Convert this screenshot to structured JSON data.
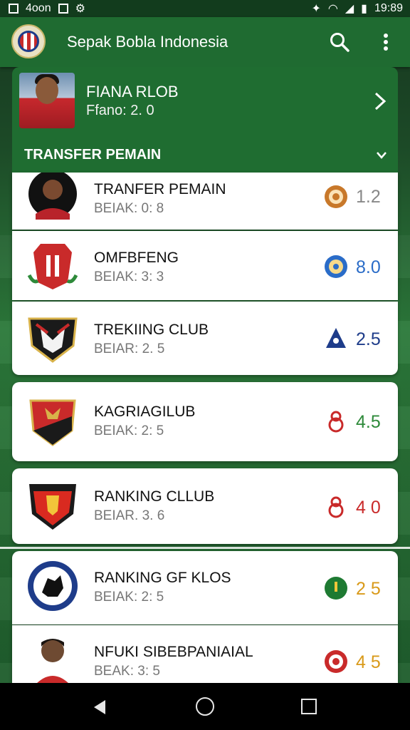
{
  "status_bar": {
    "left_text": "4oon",
    "time": "19:89"
  },
  "app_bar": {
    "title": "Sepak Bobla Indonesia",
    "icons": [
      "club-logo-icon",
      "search-icon",
      "more-vert-icon"
    ]
  },
  "featured": {
    "title": "FIANA RLOB",
    "subtitle": "Ffano: 2. 0"
  },
  "section": {
    "title": "TRANSFER PEMAIN"
  },
  "items": [
    {
      "name": "TRANFER PEMAIN",
      "sub": "BEIAK: 0: 8",
      "rank": "1.2",
      "badge_color": "#c8782a",
      "value_color": "#888888"
    },
    {
      "name": "OMFBFENG",
      "sub": "BEIAK: 3: 3",
      "rank": "8.0",
      "badge_color": "#2a6cc8",
      "value_color": "#2a6cc8"
    },
    {
      "name": "TREKIING CLUB",
      "sub": "BEIAR: 2. 5",
      "rank": "2.5",
      "badge_color": "#1e3c8a",
      "value_color": "#1e3c8a"
    },
    {
      "name": "KAGRIAGILUB",
      "sub": "BEIAK: 2: 5",
      "rank": "4.5",
      "badge_color": "#c92a2a",
      "value_color": "#2e8a3a"
    },
    {
      "name": "RANKING CLLUB",
      "sub": "BEIAR. 3. 6",
      "rank": "4 0",
      "badge_color": "#c92a2a",
      "value_color": "#c92a2a"
    },
    {
      "name": "RANKING GF KLOS",
      "sub": "BEIAK: 2: 5",
      "rank": "2 5",
      "badge_color": "#1e7a32",
      "value_color": "#d99a1a"
    },
    {
      "name": "NFUKI SIBEBPANIAIAL",
      "sub": "BEAK: 3: 5",
      "rank": "4 5",
      "badge_color": "#c92a2a",
      "value_color": "#d99a1a"
    }
  ],
  "colors": {
    "primary": "#1f6b31",
    "status_bar": "#123c1d",
    "card": "#ffffff"
  }
}
